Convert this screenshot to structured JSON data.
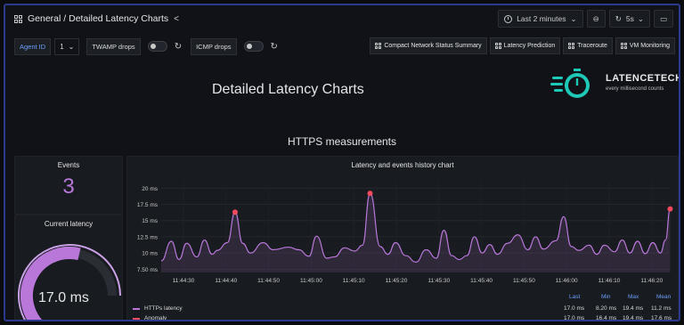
{
  "topbar": {
    "breadcrumb": "General / Detailed Latency Charts",
    "time_range": "Last 2 minutes",
    "refresh_interval": "5s"
  },
  "variables": {
    "agent_label": "Agent ID",
    "agent_value": "1",
    "twamp_label": "TWAMP drops",
    "icmp_label": "ICMP drops"
  },
  "links": [
    "Compact Network Status Summary",
    "Latency Prediction",
    "Traceroute",
    "VM Monitoring"
  ],
  "header": {
    "title": "Detailed Latency Charts",
    "logo_name": "LATENCETECH",
    "logo_tagline": "every millisecond counts",
    "section": "HTTPS measurements"
  },
  "events_panel": {
    "title": "Events",
    "value": "3"
  },
  "latency_panel": {
    "title": "Current latency",
    "value": "17.0 ms",
    "fraction": 0.68
  },
  "chart_panel": {
    "title": "Latency and events history chart"
  },
  "chart_data": {
    "type": "line",
    "title": "Latency and events history chart",
    "y_ticks": [
      "7.50 ms",
      "10 ms",
      "12.5 ms",
      "15 ms",
      "17.5 ms",
      "20 ms"
    ],
    "x_ticks": [
      "11:44:30",
      "11:44:40",
      "11:44:50",
      "11:45:00",
      "11:45:10",
      "11:45:20",
      "11:45:30",
      "11:45:40",
      "11:45:50",
      "11:46:00",
      "11:46:10",
      "11:46:20"
    ],
    "ylim": [
      7,
      21
    ],
    "series": [
      {
        "name": "HTTPs latency",
        "color": "#b877d9",
        "points": [
          [
            0,
            8.8
          ],
          [
            2,
            11.8
          ],
          [
            3.5,
            9.0
          ],
          [
            5,
            11.5
          ],
          [
            7,
            9.4
          ],
          [
            8.5,
            12.0
          ],
          [
            10,
            9.8
          ],
          [
            11,
            10.4
          ],
          [
            13,
            11.6
          ],
          [
            14.5,
            16.3
          ],
          [
            16,
            11.5
          ],
          [
            17.5,
            10.0
          ],
          [
            20,
            11.6
          ],
          [
            22,
            10.5
          ],
          [
            25,
            10.9
          ],
          [
            27,
            10.5
          ],
          [
            29,
            9.5
          ],
          [
            30.5,
            12.6
          ],
          [
            32.5,
            9.2
          ],
          [
            34,
            9.4
          ],
          [
            36,
            10.8
          ],
          [
            38,
            10.3
          ],
          [
            39.5,
            11.2
          ],
          [
            41,
            19.2
          ],
          [
            43,
            11.0
          ],
          [
            44.5,
            9.8
          ],
          [
            46,
            11.6
          ],
          [
            48,
            9.6
          ],
          [
            50,
            8.6
          ],
          [
            52,
            10.5
          ],
          [
            54,
            9.2
          ],
          [
            55.5,
            13.5
          ],
          [
            57,
            9.6
          ],
          [
            58.5,
            9.0
          ],
          [
            60,
            9.6
          ],
          [
            61.5,
            12.5
          ],
          [
            63,
            10.0
          ],
          [
            64.5,
            11.3
          ],
          [
            66,
            9.8
          ],
          [
            68,
            11.5
          ],
          [
            70,
            12.8
          ],
          [
            72,
            10.5
          ],
          [
            73.5,
            12.5
          ],
          [
            75,
            10.6
          ],
          [
            77.5,
            11.9
          ],
          [
            79,
            15.6
          ],
          [
            80.5,
            11.0
          ],
          [
            82,
            10.4
          ],
          [
            84,
            11.2
          ],
          [
            85.5,
            9.8
          ],
          [
            87,
            11.2
          ],
          [
            89,
            10.2
          ],
          [
            90.5,
            12.0
          ],
          [
            92,
            10.0
          ],
          [
            93.5,
            11.8
          ],
          [
            95,
            9.9
          ],
          [
            96.5,
            11.6
          ],
          [
            98,
            10.0
          ],
          [
            99,
            12.0
          ],
          [
            99.9,
            16.8
          ]
        ]
      }
    ],
    "anomalies": [
      [
        14.5,
        16.3
      ],
      [
        41,
        19.2
      ],
      [
        99.9,
        16.8
      ]
    ],
    "legend": [
      {
        "name": "HTTPs latency",
        "color": "#b877d9",
        "last": "17.0 ms",
        "min": "8.20 ms",
        "max": "19.4 ms",
        "mean": "11.2 ms"
      },
      {
        "name": "Anomaly",
        "color": "#f2495c",
        "last": "17.0 ms",
        "min": "16.4 ms",
        "max": "19.4 ms",
        "mean": "17.6 ms"
      }
    ],
    "stat_headers": [
      "Last",
      "Min",
      "Max",
      "Mean"
    ]
  }
}
